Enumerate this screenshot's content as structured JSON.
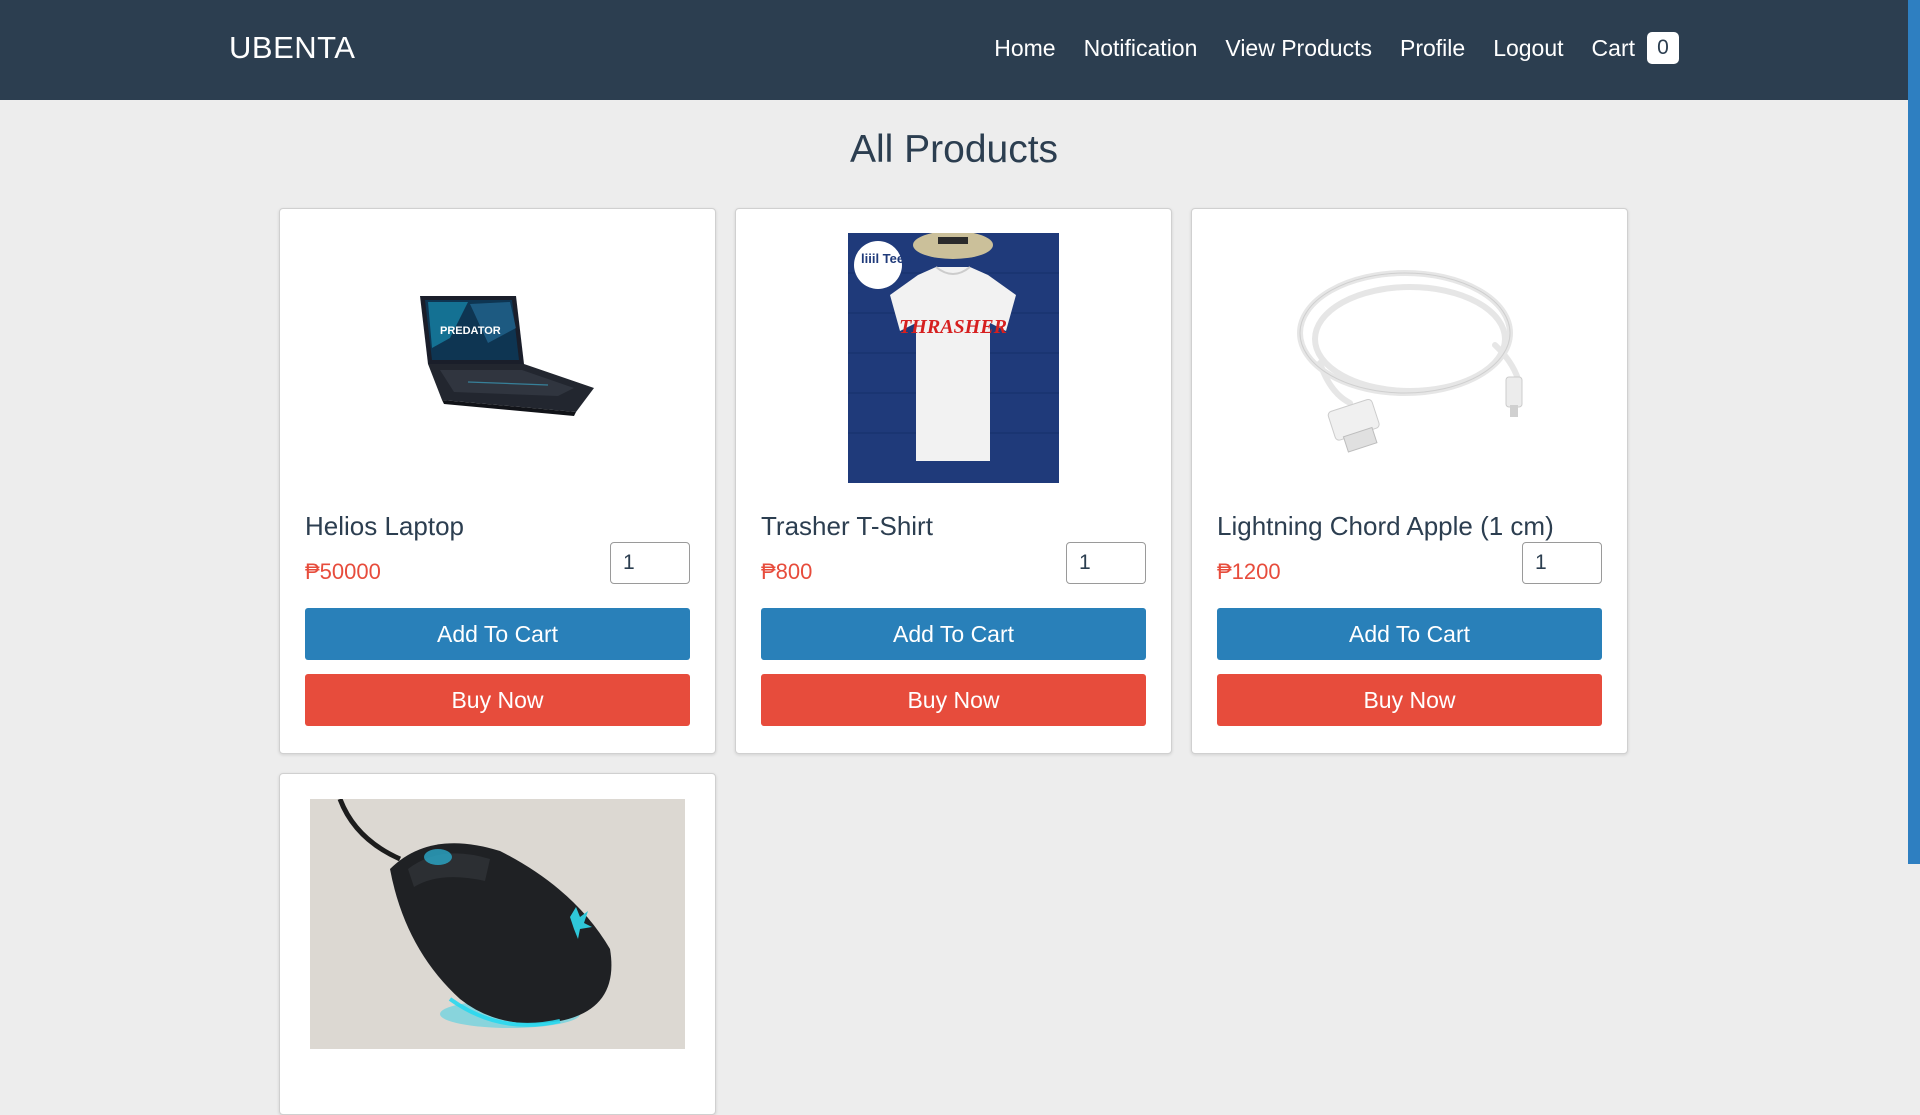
{
  "brand": "UBENTA",
  "nav": {
    "home": "Home",
    "notification": "Notification",
    "view_products": "View Products",
    "profile": "Profile",
    "logout": "Logout",
    "cart": "Cart",
    "cart_count": "0"
  },
  "page_title": "All Products",
  "products": [
    {
      "name": "Helios Laptop",
      "price": "₱50000",
      "qty": "1",
      "add_label": "Add To Cart",
      "buy_label": "Buy Now",
      "image": "laptop-image"
    },
    {
      "name": "Trasher T-Shirt",
      "price": "₱800",
      "qty": "1",
      "add_label": "Add To Cart",
      "buy_label": "Buy Now",
      "image": "tshirt-image",
      "image_text": {
        "logo": "liiil Tees",
        "print": "THRASHER"
      }
    },
    {
      "name": "Lightning Chord Apple (1 cm)",
      "price": "₱1200",
      "qty": "1",
      "add_label": "Add To Cart",
      "buy_label": "Buy Now",
      "image": "cable-image"
    },
    {
      "image": "mouse-image"
    }
  ],
  "colors": {
    "navbar": "#2c3e50",
    "background": "#ededed",
    "price": "#e74c3c",
    "add_to_cart": "#2980b9",
    "buy_now": "#e74c3c",
    "scrollbar": "#2e7fc1"
  }
}
